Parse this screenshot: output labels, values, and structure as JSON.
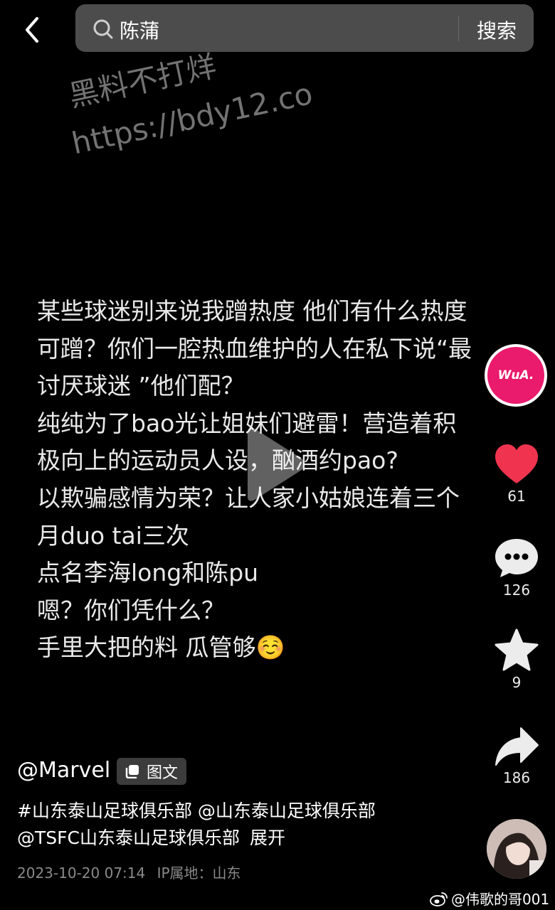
{
  "search": {
    "query": "陈蒲",
    "button_label": "搜索"
  },
  "watermark": {
    "line1": "黑料不打烊",
    "line2": "https://bdy12.co"
  },
  "post": {
    "lines": [
      "某些球迷别来说我蹭热度 他们有什么热度",
      "可蹭？你们一腔热血维护的人在私下说“最",
      "讨厌球迷 ”他们配？",
      "纯纯为了bao光让姐妹们避雷！营造着积",
      "极向上的运动员人设，酗酒约pao?",
      "以欺骗感情为荣？让人家小姑娘连着三个",
      "月duo tai三次",
      "点名李海long和陈pu",
      "嗯？你们凭什么？",
      "手里大把的料 瓜管够☺️"
    ]
  },
  "actions": {
    "creator_avatar_text": "WuA.",
    "likes": "61",
    "comments": "126",
    "favorites": "9",
    "shares": "186"
  },
  "author": {
    "name": "@Marvel",
    "post_type": "图文"
  },
  "caption": {
    "line1": "#山东泰山足球俱乐部 @山东泰山足球俱乐部",
    "line2": "@TSFC山东泰山足球俱乐部",
    "expand_label": "展开"
  },
  "meta": {
    "datetime": "2023-10-20 07:14",
    "ip_location": "IP属地：山东"
  },
  "credit": {
    "text": "@伟歌的哥001"
  },
  "colors": {
    "background": "#000000",
    "search_bg": "#4c4c4c",
    "like_red": "#f0344f",
    "avatar_pink": "#ea1a6c"
  },
  "icons": [
    "back-arrow-icon",
    "search-icon",
    "play-icon",
    "heart-icon",
    "comment-icon",
    "star-icon",
    "share-icon",
    "image-text-icon",
    "weibo-icon"
  ]
}
